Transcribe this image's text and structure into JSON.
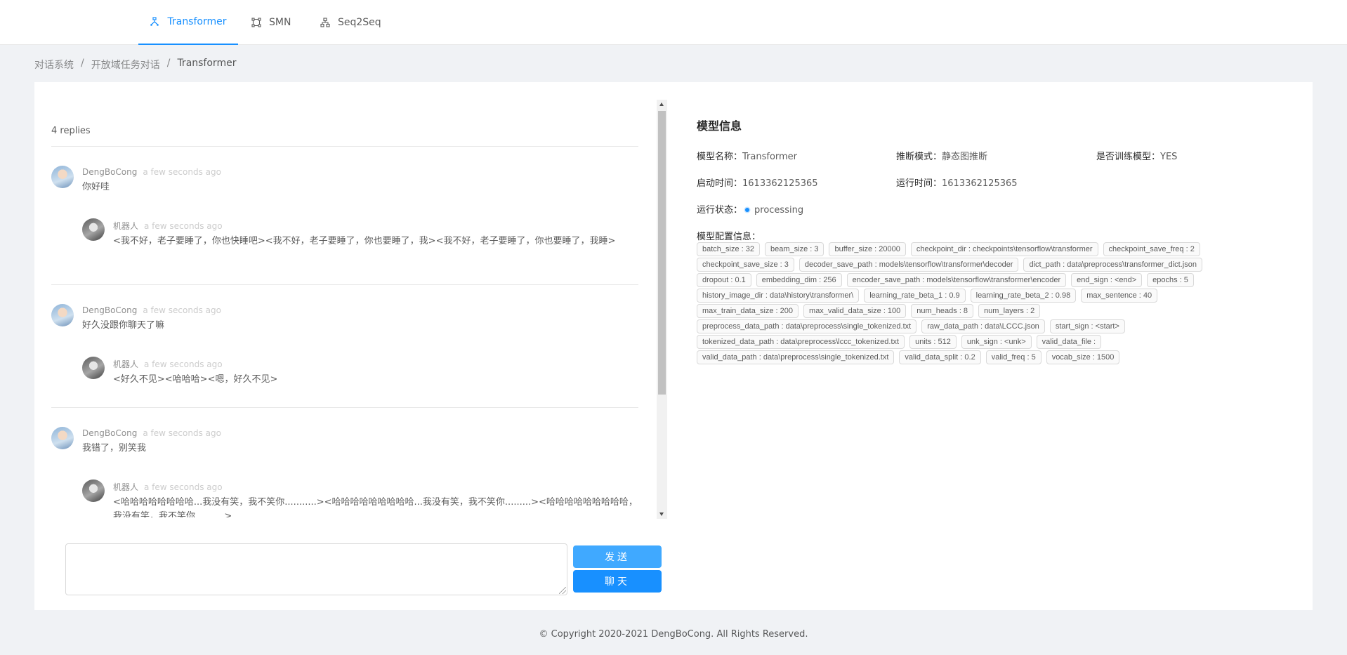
{
  "nav": {
    "tabs": [
      {
        "label": "Transformer",
        "icon": "apartment-icon",
        "active": true
      },
      {
        "label": "SMN",
        "icon": "node-expand-icon",
        "active": false
      },
      {
        "label": "Seq2Seq",
        "icon": "cluster-icon",
        "active": false
      }
    ]
  },
  "breadcrumb": [
    "对话系统",
    "开放域任务对话",
    "Transformer"
  ],
  "chat": {
    "replies_count": "4 replies",
    "comments": [
      {
        "user": {
          "author": "DengBoCong",
          "time": "a few seconds ago",
          "text": "你好哇"
        },
        "bot": {
          "author": "机器人",
          "time": "a few seconds ago",
          "text": "<我不好，老子要睡了，你也快睡吧><我不好，老子要睡了，你也要睡了，我><我不好，老子要睡了，你也要睡了，我睡>"
        }
      },
      {
        "user": {
          "author": "DengBoCong",
          "time": "a few seconds ago",
          "text": "好久没跟你聊天了嘛"
        },
        "bot": {
          "author": "机器人",
          "time": "a few seconds ago",
          "text": "<好久不见><哈哈哈><嗯，好久不见>"
        }
      },
      {
        "user": {
          "author": "DengBoCong",
          "time": "a few seconds ago",
          "text": "我错了，别笑我"
        },
        "bot": {
          "author": "机器人",
          "time": "a few seconds ago",
          "text": "<哈哈哈哈哈哈哈哈...我没有笑，我不笑你...........><哈哈哈哈哈哈哈哈哈...我没有笑，我不笑你.........><哈哈哈哈哈哈哈哈哈，我没有笑，我不笑你..........>"
        }
      }
    ],
    "input_value": "",
    "send_label": "发送",
    "chat_label": "聊天"
  },
  "model_info": {
    "title": "模型信息",
    "name_key": "模型名称：",
    "name_value": "Transformer",
    "infer_key": "推断模式：",
    "infer_value": "静态图推断",
    "trained_key": "是否训练模型：",
    "trained_value": "YES",
    "start_key": "启动时间：",
    "start_value": "1613362125365",
    "run_key": "运行时间：",
    "run_value": "1613362125365",
    "status_key": "运行状态：",
    "status_value": "processing",
    "config_label": "模型配置信息：",
    "config": [
      "batch_size : 32",
      "beam_size : 3",
      "buffer_size : 20000",
      "checkpoint_dir : checkpoints\\tensorflow\\transformer",
      "checkpoint_save_freq : 2",
      "checkpoint_save_size : 3",
      "decoder_save_path : models\\tensorflow\\transformer\\decoder",
      "dict_path : data\\preprocess\\transformer_dict.json",
      "dropout : 0.1",
      "embedding_dim : 256",
      "encoder_save_path : models\\tensorflow\\transformer\\encoder",
      "end_sign : <end>",
      "epochs : 5",
      "history_image_dir : data\\history\\transformer\\",
      "learning_rate_beta_1 : 0.9",
      "learning_rate_beta_2 : 0.98",
      "max_sentence : 40",
      "max_train_data_size : 200",
      "max_valid_data_size : 100",
      "num_heads : 8",
      "num_layers : 2",
      "preprocess_data_path : data\\preprocess\\single_tokenized.txt",
      "raw_data_path : data\\LCCC.json",
      "start_sign : <start>",
      "tokenized_data_path : data\\preprocess\\lccc_tokenized.txt",
      "units : 512",
      "unk_sign : <unk>",
      "valid_data_file :",
      "valid_data_path : data\\preprocess\\single_tokenized.txt",
      "valid_data_split : 0.2",
      "valid_freq : 5",
      "vocab_size : 1500"
    ]
  },
  "footer": "© Copyright 2020-2021 DengBoCong. All Rights Reserved."
}
